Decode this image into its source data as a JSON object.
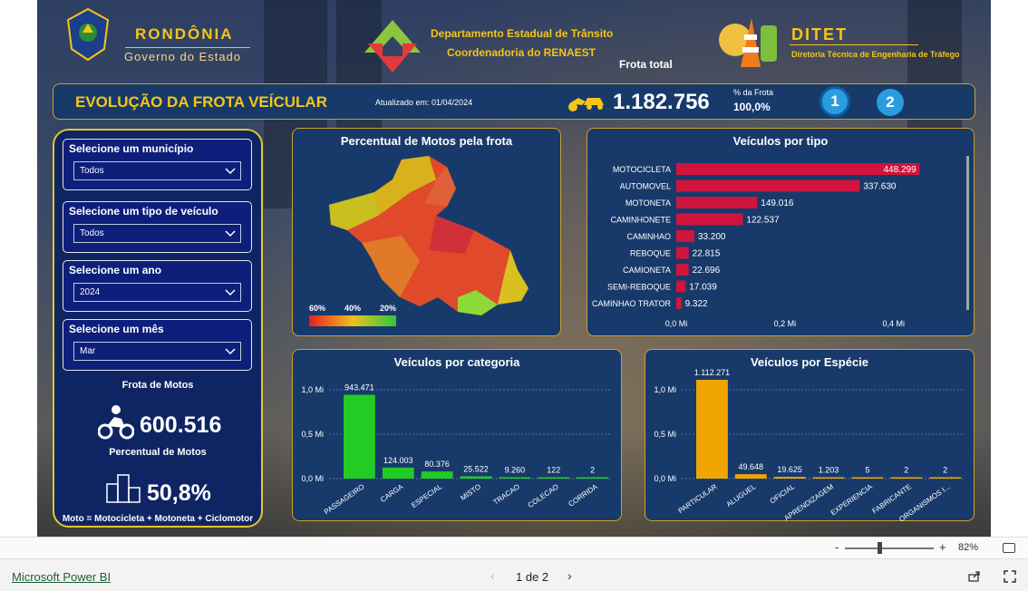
{
  "header": {
    "state": "RONDÔNIA",
    "state_sub": "Governo do Estado",
    "dept1": "Departamento Estadual de Trânsito",
    "dept2": "Coordenadoria do RENAEST",
    "ditet": "DITET",
    "ditet_sub": "Diretoria Técnica de Engenharia de Tráfego",
    "frota_label": "Frota total",
    "title": "EVOLUÇÃO DA FROTA VEÍCULAR",
    "updated": "Atualizado em: 01/04/2024",
    "total": "1.182.756",
    "pct_label": "% da Frota",
    "pct_value": "100,0%",
    "page1": "1",
    "page2": "2"
  },
  "filters": [
    {
      "label": "Selecione um município",
      "value": "Todos"
    },
    {
      "label": "Selecione um tipo de veículo",
      "value": "Todos"
    },
    {
      "label": "Selecione um ano",
      "value": "2024"
    },
    {
      "label": "Selecione um mês",
      "value": "Mar"
    }
  ],
  "motos": {
    "frota_label": "Frota de Motos",
    "frota_value": "600.516",
    "pct_label": "Percentual de Motos",
    "pct_value": "50,8%",
    "note": "Moto = Motocicleta + Motoneta + Ciclomotor"
  },
  "map": {
    "title": "Percentual de Motos pela frota",
    "legend": [
      "60%",
      "40%",
      "20%"
    ]
  },
  "chart_data": [
    {
      "type": "bar",
      "orientation": "horizontal",
      "title": "Veículos por tipo",
      "categories": [
        "MOTOCICLETA",
        "AUTOMOVEL",
        "MOTONETA",
        "CAMINHONETE",
        "CAMINHAO",
        "REBOQUE",
        "CAMIONETA",
        "SEMI-REBOQUE",
        "CAMINHAO TRATOR"
      ],
      "values": [
        448299,
        337630,
        149016,
        122537,
        33200,
        22815,
        22696,
        17039,
        9322
      ],
      "labels": [
        "448.299",
        "337.630",
        "149.016",
        "122.537",
        "33.200",
        "22.815",
        "22.696",
        "17.039",
        "9.322"
      ],
      "xticks": [
        "0,0 Mi",
        "0,2 Mi",
        "0,4 Mi"
      ],
      "xlim": [
        0,
        0.4
      ],
      "color": "#d0143c"
    },
    {
      "type": "bar",
      "title": "Veículos por categoria",
      "categories": [
        "PASSAGEIRO",
        "CARGA",
        "ESPECIAL",
        "MISTO",
        "TRACAO",
        "COLECAO",
        "CORRIDA"
      ],
      "values": [
        943471,
        124003,
        80376,
        25522,
        9260,
        122,
        2
      ],
      "labels": [
        "943.471",
        "124.003",
        "80.376",
        "25.522",
        "9.260",
        "122",
        "2"
      ],
      "yticks": [
        "1,0 Mi",
        "0,5 Mi",
        "0,0 Mi"
      ],
      "ylim": [
        0,
        1000000
      ],
      "color": "#22cc22"
    },
    {
      "type": "bar",
      "title": "Veículos por Espécie",
      "categories": [
        "PARTICULAR",
        "ALUGUEL",
        "OFICIAL",
        "APRENDIZAGEM",
        "EXPERIENCIA",
        "FABRICANTE",
        "ORGANISMOS I..."
      ],
      "values": [
        1112271,
        49648,
        19625,
        1203,
        5,
        2,
        2
      ],
      "labels": [
        "1.112.271",
        "49.648",
        "19.625",
        "1.203",
        "5",
        "2",
        "2"
      ],
      "yticks": [
        "1,0 Mi",
        "0,5 Mi",
        "0,0 Mi"
      ],
      "ylim": [
        0,
        1000000
      ],
      "color": "#f0a500"
    }
  ],
  "footer": {
    "brand": "Microsoft Power BI",
    "page": "1 de 2",
    "zoom": "82%",
    "minus": "-",
    "plus": "+"
  }
}
